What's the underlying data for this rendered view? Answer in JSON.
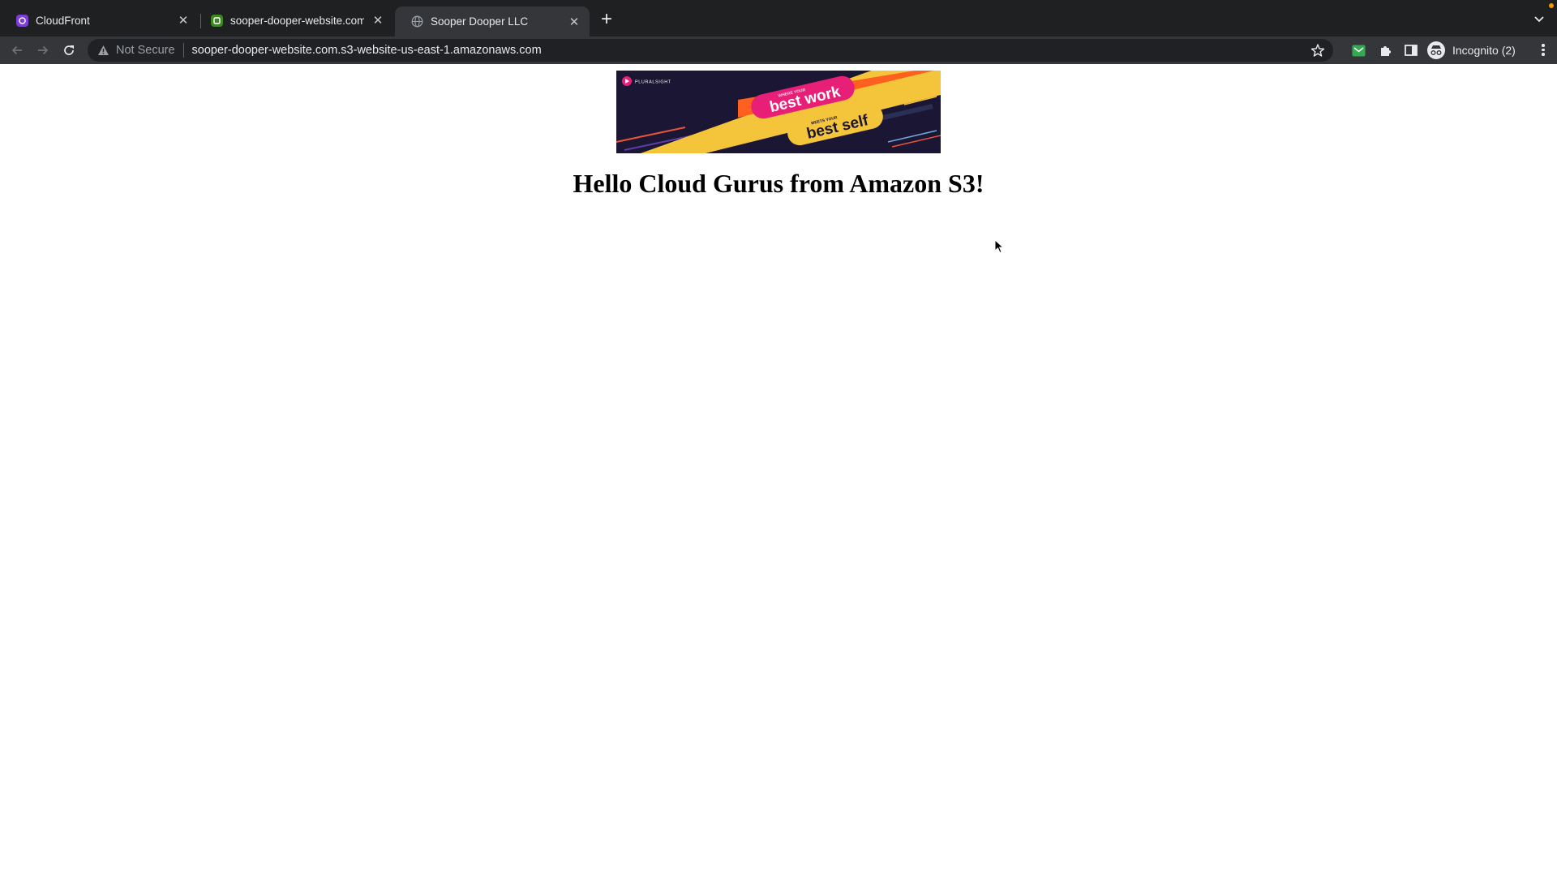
{
  "tabs": [
    {
      "title": "CloudFront",
      "active": false,
      "favicon": "cloudfront-icon",
      "favicon_color": "#7b3fd6"
    },
    {
      "title": "sooper-dooper-website.com - ",
      "active": false,
      "favicon": "s3-bucket-icon",
      "favicon_color": "#3f8624"
    },
    {
      "title": "Sooper Dooper LLC",
      "active": true,
      "favicon": "globe-icon",
      "favicon_color": "#9aa0a6"
    }
  ],
  "toolbar": {
    "security_label": "Not Secure",
    "url": "sooper-dooper-website.com.s3-website-us-east-1.amazonaws.com",
    "profile_label": "Incognito (2)"
  },
  "page": {
    "banner": {
      "brand": "PLURALSIGHT",
      "line1_small": "WHERE YOUR",
      "line1": "best work",
      "line2_small": "MEETS YOUR",
      "line2": "best self"
    },
    "headline": "Hello Cloud Gurus from Amazon S3!"
  },
  "colors": {
    "tab_strip": "#1f2022",
    "toolbar": "#35363a",
    "omnibox": "#202124",
    "banner_bg": "#1a1633",
    "banner_pink": "#e81f76",
    "banner_yellow": "#f4c53a"
  }
}
